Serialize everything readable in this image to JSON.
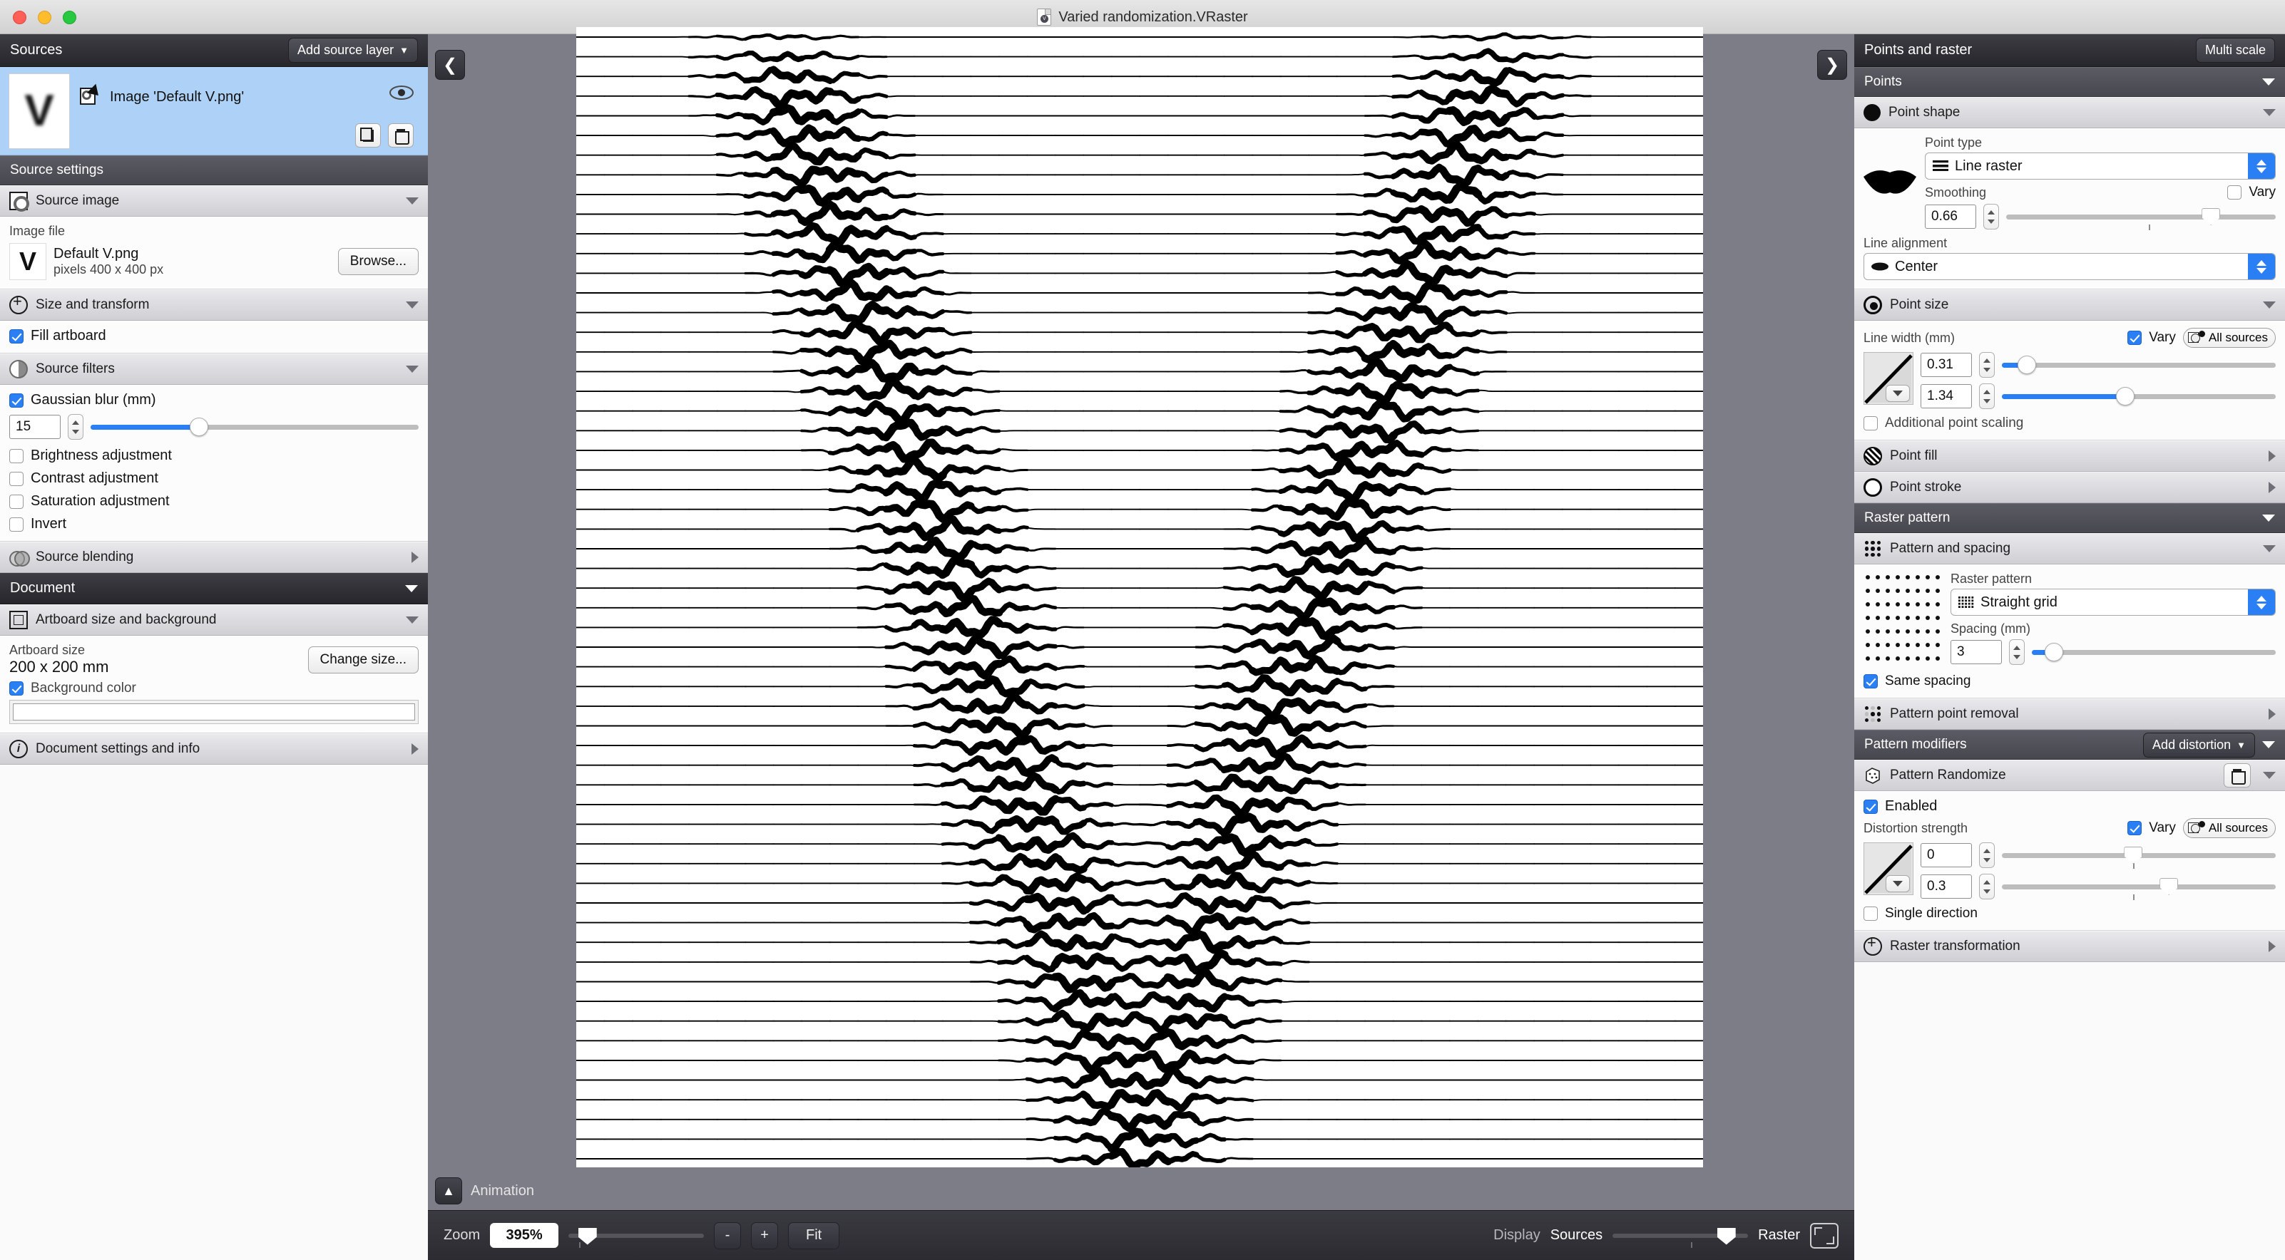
{
  "window": {
    "title": "Varied randomization.VRaster"
  },
  "left_panel": {
    "header": {
      "title": "Sources",
      "add_button": "Add source layer"
    },
    "layer": {
      "name": "Image 'Default V.png'",
      "thumb_letter": "V"
    },
    "source_settings_title": "Source settings",
    "source_image": {
      "section": "Source image",
      "image_file_label": "Image file",
      "file_name": "Default V.png",
      "file_meta": "pixels 400 x 400 px",
      "browse_button": "Browse...",
      "thumb_letter": "V"
    },
    "size_transform": {
      "section": "Size and transform",
      "fill_artboard": "Fill artboard",
      "fill_artboard_checked": true
    },
    "source_filters": {
      "section": "Source filters",
      "gaussian_blur_label": "Gaussian blur (mm)",
      "gaussian_blur_checked": true,
      "gaussian_blur_value": "15",
      "gaussian_blur_pct": 33,
      "brightness": "Brightness adjustment",
      "contrast": "Contrast adjustment",
      "saturation": "Saturation adjustment",
      "invert": "Invert"
    },
    "source_blending": {
      "section": "Source blending"
    },
    "document_title": "Document",
    "artboard": {
      "section": "Artboard size and background",
      "size_label": "Artboard size",
      "size_value": "200 x 200 mm",
      "change_button": "Change size...",
      "background_color_label": "Background color",
      "background_color_checked": true,
      "background_color": "#ffffff"
    },
    "doc_info": {
      "section": "Document settings and info"
    }
  },
  "right_panel": {
    "header": {
      "title": "Points and raster",
      "multi_scale_button": "Multi scale"
    },
    "points_title": "Points",
    "point_shape": {
      "section": "Point shape",
      "point_type_label": "Point type",
      "point_type_value": "Line raster",
      "smoothing_label": "Smoothing",
      "smoothing_value": "0.66",
      "smoothing_pct": 76,
      "vary_label": "Vary",
      "vary_checked": false,
      "line_alignment_label": "Line alignment",
      "line_alignment_value": "Center"
    },
    "point_size": {
      "section": "Point size",
      "line_width_label": "Line width (mm)",
      "vary_label": "Vary",
      "vary_checked": true,
      "all_sources_label": "All sources",
      "min_value": "0.31",
      "min_pct": 9,
      "max_value": "1.34",
      "max_pct": 45,
      "additional_scaling_label": "Additional point scaling",
      "additional_scaling_checked": false
    },
    "point_fill": {
      "section": "Point fill"
    },
    "point_stroke": {
      "section": "Point stroke"
    },
    "raster_pattern_title": "Raster pattern",
    "pattern_spacing": {
      "section": "Pattern and spacing",
      "raster_pattern_label": "Raster pattern",
      "raster_pattern_value": "Straight grid",
      "spacing_label": "Spacing (mm)",
      "spacing_value": "3",
      "spacing_pct": 9,
      "same_spacing_label": "Same spacing",
      "same_spacing_checked": true
    },
    "pattern_point_removal": {
      "section": "Pattern point removal"
    },
    "pattern_modifiers_title": "Pattern modifiers",
    "add_distortion_button": "Add distortion",
    "pattern_randomize": {
      "section": "Pattern Randomize",
      "enabled_label": "Enabled",
      "enabled_checked": true,
      "distortion_strength_label": "Distortion strength",
      "vary_label": "Vary",
      "vary_checked": true,
      "all_sources_label": "All sources",
      "min_value": "0",
      "min_pct": 48,
      "max_value": "0.3",
      "max_pct": 61,
      "single_direction_label": "Single direction",
      "single_direction_checked": false
    },
    "raster_transformation": {
      "section": "Raster transformation"
    }
  },
  "bottom_bar": {
    "zoom_label": "Zoom",
    "zoom_value": "395%",
    "zoom_pct": 14,
    "minus_button": "-",
    "plus_button": "+",
    "fit_button": "Fit",
    "display_label": "Display",
    "display_left": "Sources",
    "display_right": "Raster",
    "display_pct": 84,
    "animation_label": "Animation"
  },
  "colors": {
    "accent": "#2b7ff5",
    "selection": "#aed2f7",
    "canvas_bg": "#7d7d88",
    "panel_bg": "#fafafa"
  }
}
